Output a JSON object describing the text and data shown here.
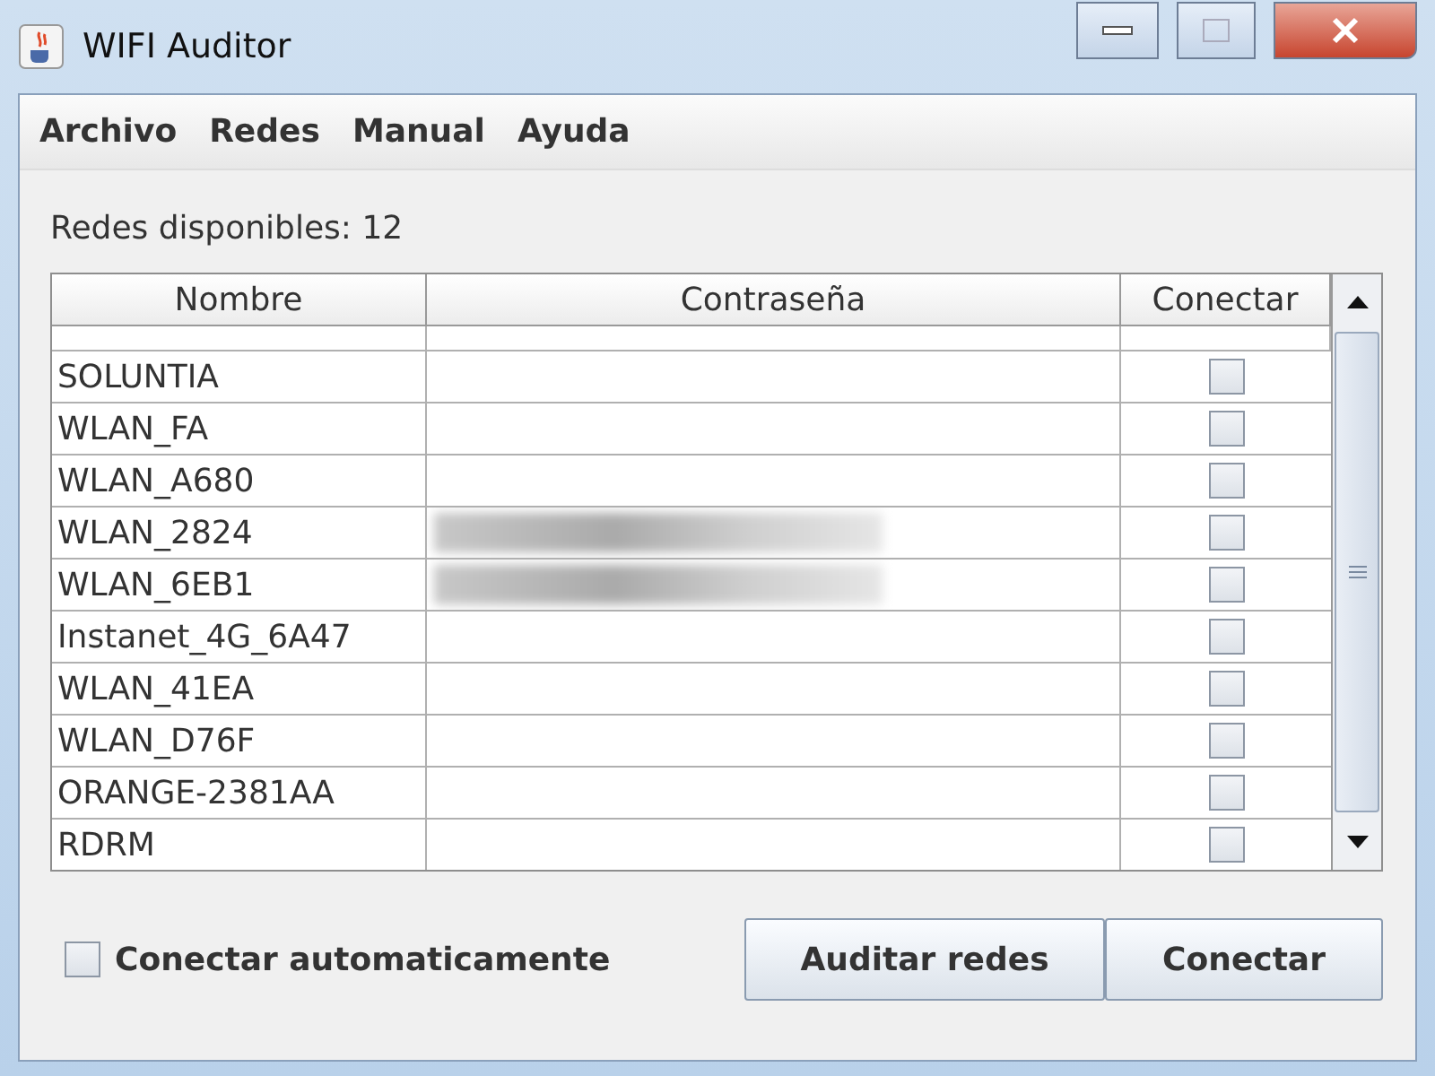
{
  "window": {
    "title": "WIFI Auditor"
  },
  "menu": [
    "Archivo",
    "Redes",
    "Manual",
    "Ayuda"
  ],
  "available_label": "Redes disponibles: 12",
  "table": {
    "columns": [
      "Nombre",
      "Contraseña",
      "Conectar"
    ],
    "rows": [
      {
        "name": "SOLUNTIA",
        "password_blurred": false,
        "checked": false
      },
      {
        "name": "WLAN_FA",
        "password_blurred": false,
        "checked": false
      },
      {
        "name": "WLAN_A680",
        "password_blurred": false,
        "checked": false
      },
      {
        "name": "WLAN_2824",
        "password_blurred": true,
        "checked": false
      },
      {
        "name": "WLAN_6EB1",
        "password_blurred": true,
        "checked": false
      },
      {
        "name": "Instanet_4G_6A47",
        "password_blurred": false,
        "checked": false
      },
      {
        "name": "WLAN_41EA",
        "password_blurred": false,
        "checked": false
      },
      {
        "name": "WLAN_D76F",
        "password_blurred": false,
        "checked": false
      },
      {
        "name": "ORANGE-2381AA",
        "password_blurred": false,
        "checked": false
      },
      {
        "name": "RDRM",
        "password_blurred": false,
        "checked": false
      }
    ]
  },
  "auto_connect": {
    "label": "Conectar automaticamente",
    "checked": false
  },
  "buttons": [
    "Auditar redes",
    "Conectar"
  ]
}
